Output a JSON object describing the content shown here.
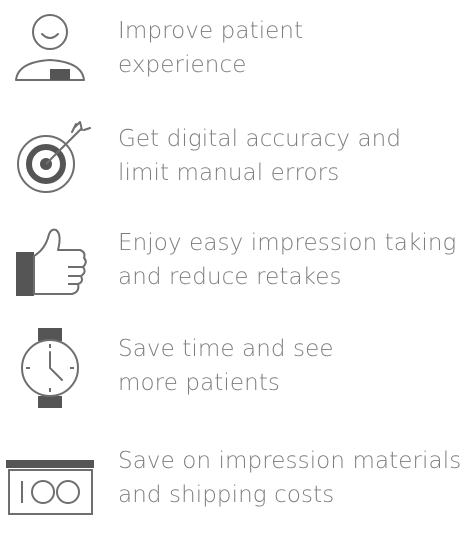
{
  "colors": {
    "text": "#7d7d7d",
    "icon_stroke": "#6e6e6e",
    "icon_fill": "#555555"
  },
  "benefits": [
    {
      "icon": "patient-icon",
      "line1": "Improve patient",
      "line2": "experience"
    },
    {
      "icon": "target-icon",
      "line1": "Get digital accuracy and",
      "line2": "limit manual errors"
    },
    {
      "icon": "thumbs-up-icon",
      "line1": "Enjoy easy impression taking",
      "line2": "and reduce retakes"
    },
    {
      "icon": "watch-icon",
      "line1": "Save time and see",
      "line2": "more patients"
    },
    {
      "icon": "money-icon",
      "line1": "Save on impression materials",
      "line2": "and shipping costs"
    }
  ]
}
